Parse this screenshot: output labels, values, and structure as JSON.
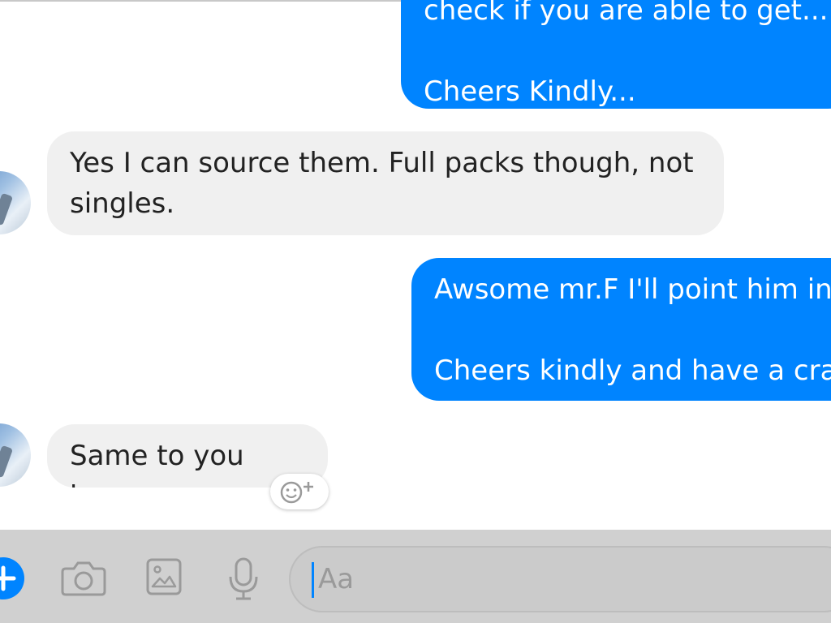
{
  "messages": [
    {
      "direction": "outgoing",
      "lines": [
        "check if you are able to get....",
        "",
        "Cheers Kindly..."
      ]
    },
    {
      "direction": "incoming",
      "lines": [
        "Yes I can source them. Full packs though, not",
        "singles."
      ]
    },
    {
      "direction": "outgoing",
      "lines": [
        "Awsome mr.F I'll point him in",
        "",
        "Cheers kindly and have a cra"
      ]
    },
    {
      "direction": "incoming",
      "lines": [
        "Same to you bro."
      ]
    }
  ],
  "composer": {
    "placeholder": "Aa",
    "icons": [
      "plus-icon",
      "camera-icon",
      "image-icon",
      "microphone-icon"
    ]
  },
  "reaction_icon": "emoji-plus-icon",
  "colors": {
    "outgoing_bubble": "#0084ff",
    "incoming_bubble": "#f0f0f0",
    "composer_bar": "#d0d0d0",
    "accent": "#0084ff"
  }
}
